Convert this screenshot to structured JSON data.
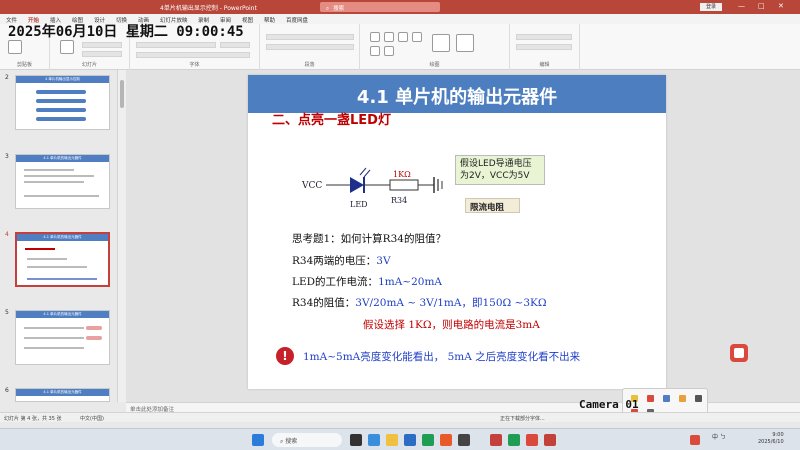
{
  "titlebar": {
    "title": "4单片机输出显示控制 - PowerPoint",
    "search_placeholder": "搜索",
    "login": "登录",
    "minimize": "—",
    "maximize": "□",
    "close": "✕"
  },
  "ribbon": {
    "tabs": [
      "文件",
      "开始",
      "插入",
      "绘图",
      "设计",
      "切换",
      "动画",
      "幻灯片放映",
      "录制",
      "审阅",
      "视图",
      "帮助",
      "百度网盘"
    ],
    "groups": [
      "剪贴板",
      "幻灯片",
      "字体",
      "段落",
      "绘图",
      "编辑"
    ]
  },
  "overlay": {
    "datetime": "2025年06月10日  星期二  09:00:45",
    "camera": "Camera 01"
  },
  "thumbnails": [
    {
      "num": "2",
      "title": "4 单片机输出显示控制"
    },
    {
      "num": "3",
      "title": "4.1 单片机的输出元器件"
    },
    {
      "num": "4",
      "title": "4.1 单片机的输出元器件"
    },
    {
      "num": "5",
      "title": "4.1 单片机的输出元器件"
    },
    {
      "num": "6",
      "title": "4.1 单片机的输出元器件"
    }
  ],
  "slide": {
    "title": "4.1 单片机的输出元器件",
    "subtitle": "二、点亮一盏LED灯",
    "circuit": {
      "vcc": "VCC",
      "led": "LED",
      "r_value": "1KΩ",
      "r_name": "R34"
    },
    "note": "假设LED导通电压为2V，VCC为5V",
    "resist_label": "限流电阻",
    "question": "思考题1：如何计算R34的阻值？",
    "line1_prefix": "R34两端的电压：",
    "line1_value": "3V",
    "line2_prefix": "LED的工作电流：",
    "line2_value": "1mA~20mA",
    "line3_prefix": "R34的阻值：",
    "line3_value": "3V/20mA ~ 3V/1mA，即150Ω ~3KΩ",
    "line4": "假设选择 1KΩ，则电路的电流是3mA",
    "warning_icon": "!",
    "warning": "1mA~5mA亮度变化能看出，  5mA 之后亮度变化看不出来"
  },
  "notes_placeholder": "单击此处添加备注",
  "status": {
    "left": "幻灯片 第 4 张，共 35 张",
    "lang": "中文(中国)",
    "right": "正在下载部分字体..."
  },
  "taskbar": {
    "search": "搜索",
    "tray_text": "中 ㄅ",
    "time": "9:00",
    "date": "2025/6/10"
  },
  "colors": {
    "accent": "#b8473a",
    "slide_banner": "#4d7fc0",
    "red_text": "#c00000",
    "blue_text": "#1f3fc7"
  }
}
